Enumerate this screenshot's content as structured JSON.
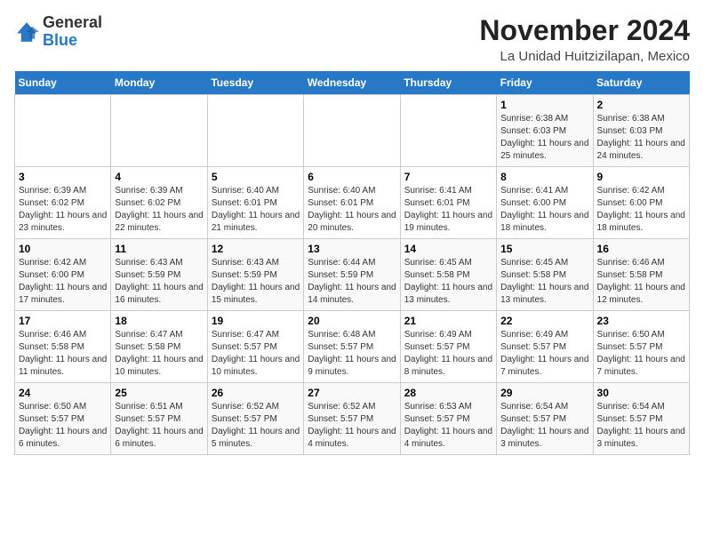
{
  "header": {
    "logo_general": "General",
    "logo_blue": "Blue",
    "month_year": "November 2024",
    "location": "La Unidad Huitzizilapan, Mexico"
  },
  "days_of_week": [
    "Sunday",
    "Monday",
    "Tuesday",
    "Wednesday",
    "Thursday",
    "Friday",
    "Saturday"
  ],
  "weeks": [
    [
      {
        "day": "",
        "info": ""
      },
      {
        "day": "",
        "info": ""
      },
      {
        "day": "",
        "info": ""
      },
      {
        "day": "",
        "info": ""
      },
      {
        "day": "",
        "info": ""
      },
      {
        "day": "1",
        "info": "Sunrise: 6:38 AM\nSunset: 6:03 PM\nDaylight: 11 hours and 25 minutes."
      },
      {
        "day": "2",
        "info": "Sunrise: 6:38 AM\nSunset: 6:03 PM\nDaylight: 11 hours and 24 minutes."
      }
    ],
    [
      {
        "day": "3",
        "info": "Sunrise: 6:39 AM\nSunset: 6:02 PM\nDaylight: 11 hours and 23 minutes."
      },
      {
        "day": "4",
        "info": "Sunrise: 6:39 AM\nSunset: 6:02 PM\nDaylight: 11 hours and 22 minutes."
      },
      {
        "day": "5",
        "info": "Sunrise: 6:40 AM\nSunset: 6:01 PM\nDaylight: 11 hours and 21 minutes."
      },
      {
        "day": "6",
        "info": "Sunrise: 6:40 AM\nSunset: 6:01 PM\nDaylight: 11 hours and 20 minutes."
      },
      {
        "day": "7",
        "info": "Sunrise: 6:41 AM\nSunset: 6:01 PM\nDaylight: 11 hours and 19 minutes."
      },
      {
        "day": "8",
        "info": "Sunrise: 6:41 AM\nSunset: 6:00 PM\nDaylight: 11 hours and 18 minutes."
      },
      {
        "day": "9",
        "info": "Sunrise: 6:42 AM\nSunset: 6:00 PM\nDaylight: 11 hours and 18 minutes."
      }
    ],
    [
      {
        "day": "10",
        "info": "Sunrise: 6:42 AM\nSunset: 6:00 PM\nDaylight: 11 hours and 17 minutes."
      },
      {
        "day": "11",
        "info": "Sunrise: 6:43 AM\nSunset: 5:59 PM\nDaylight: 11 hours and 16 minutes."
      },
      {
        "day": "12",
        "info": "Sunrise: 6:43 AM\nSunset: 5:59 PM\nDaylight: 11 hours and 15 minutes."
      },
      {
        "day": "13",
        "info": "Sunrise: 6:44 AM\nSunset: 5:59 PM\nDaylight: 11 hours and 14 minutes."
      },
      {
        "day": "14",
        "info": "Sunrise: 6:45 AM\nSunset: 5:58 PM\nDaylight: 11 hours and 13 minutes."
      },
      {
        "day": "15",
        "info": "Sunrise: 6:45 AM\nSunset: 5:58 PM\nDaylight: 11 hours and 13 minutes."
      },
      {
        "day": "16",
        "info": "Sunrise: 6:46 AM\nSunset: 5:58 PM\nDaylight: 11 hours and 12 minutes."
      }
    ],
    [
      {
        "day": "17",
        "info": "Sunrise: 6:46 AM\nSunset: 5:58 PM\nDaylight: 11 hours and 11 minutes."
      },
      {
        "day": "18",
        "info": "Sunrise: 6:47 AM\nSunset: 5:58 PM\nDaylight: 11 hours and 10 minutes."
      },
      {
        "day": "19",
        "info": "Sunrise: 6:47 AM\nSunset: 5:57 PM\nDaylight: 11 hours and 10 minutes."
      },
      {
        "day": "20",
        "info": "Sunrise: 6:48 AM\nSunset: 5:57 PM\nDaylight: 11 hours and 9 minutes."
      },
      {
        "day": "21",
        "info": "Sunrise: 6:49 AM\nSunset: 5:57 PM\nDaylight: 11 hours and 8 minutes."
      },
      {
        "day": "22",
        "info": "Sunrise: 6:49 AM\nSunset: 5:57 PM\nDaylight: 11 hours and 7 minutes."
      },
      {
        "day": "23",
        "info": "Sunrise: 6:50 AM\nSunset: 5:57 PM\nDaylight: 11 hours and 7 minutes."
      }
    ],
    [
      {
        "day": "24",
        "info": "Sunrise: 6:50 AM\nSunset: 5:57 PM\nDaylight: 11 hours and 6 minutes."
      },
      {
        "day": "25",
        "info": "Sunrise: 6:51 AM\nSunset: 5:57 PM\nDaylight: 11 hours and 6 minutes."
      },
      {
        "day": "26",
        "info": "Sunrise: 6:52 AM\nSunset: 5:57 PM\nDaylight: 11 hours and 5 minutes."
      },
      {
        "day": "27",
        "info": "Sunrise: 6:52 AM\nSunset: 5:57 PM\nDaylight: 11 hours and 4 minutes."
      },
      {
        "day": "28",
        "info": "Sunrise: 6:53 AM\nSunset: 5:57 PM\nDaylight: 11 hours and 4 minutes."
      },
      {
        "day": "29",
        "info": "Sunrise: 6:54 AM\nSunset: 5:57 PM\nDaylight: 11 hours and 3 minutes."
      },
      {
        "day": "30",
        "info": "Sunrise: 6:54 AM\nSunset: 5:57 PM\nDaylight: 11 hours and 3 minutes."
      }
    ]
  ]
}
